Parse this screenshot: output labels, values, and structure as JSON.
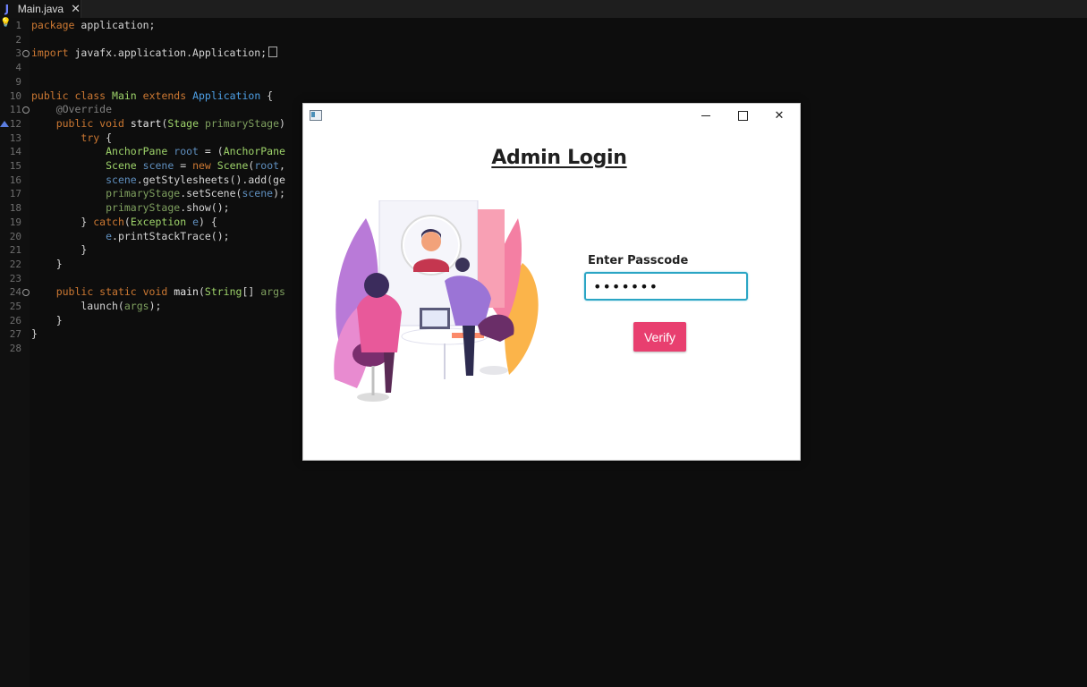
{
  "tab": {
    "icon": "J",
    "label": "Main.java",
    "close": "✕"
  },
  "code": [
    {
      "n": "1",
      "html": "<span class=\"kw\">package</span> application;"
    },
    {
      "n": "2",
      "html": ""
    },
    {
      "n": "3",
      "html": "<span class=\"kw\">import</span> javafx.application.Application;<span class=\"import-box\"></span>"
    },
    {
      "n": "4",
      "html": ""
    },
    {
      "n": "9",
      "html": ""
    },
    {
      "n": "10",
      "html": "<span class=\"kw\">public class</span> <span class=\"cls\">Main</span> <span class=\"kw\">extends</span> <span class=\"typ\">Application</span> {"
    },
    {
      "n": "11",
      "html": "    <span class=\"ann\">@Override</span>"
    },
    {
      "n": "12",
      "html": "    <span class=\"kw\">public void</span> <span class=\"fn\">start</span>(<span class=\"cls\">Stage</span> <span class=\"arg\">primaryStage</span>)"
    },
    {
      "n": "13",
      "html": "        <span class=\"kw\">try</span> {"
    },
    {
      "n": "14",
      "html": "            <span class=\"cls\">AnchorPane</span> <span class=\"var\">root</span> = (<span class=\"cls\">AnchorPane</span>"
    },
    {
      "n": "15",
      "html": "            <span class=\"cls\">Scene</span> <span class=\"var\">scene</span> = <span class=\"kw\">new</span> <span class=\"cls\">Scene</span>(<span class=\"var\">root</span>,"
    },
    {
      "n": "16",
      "html": "            <span class=\"var\">scene</span>.getStylesheets().add(ge"
    },
    {
      "n": "17",
      "html": "            <span class=\"arg\">primaryStage</span>.setScene(<span class=\"var\">scene</span>);"
    },
    {
      "n": "18",
      "html": "            <span class=\"arg\">primaryStage</span>.show();"
    },
    {
      "n": "19",
      "html": "        } <span class=\"kw\">catch</span>(<span class=\"cls\">Exception</span> <span class=\"var\">e</span>) {"
    },
    {
      "n": "20",
      "html": "            <span class=\"var\">e</span>.printStackTrace();"
    },
    {
      "n": "21",
      "html": "        }"
    },
    {
      "n": "22",
      "html": "    }"
    },
    {
      "n": "23",
      "html": ""
    },
    {
      "n": "24",
      "html": "    <span class=\"kw\">public static void</span> <span class=\"fn\">main</span>(<span class=\"cls\">String</span>[] <span class=\"arg\">args</span>"
    },
    {
      "n": "25",
      "html": "        launch(<span class=\"arg\">args</span>);"
    },
    {
      "n": "26",
      "html": "    }"
    },
    {
      "n": "27",
      "html": "}"
    },
    {
      "n": "28",
      "html": ""
    }
  ],
  "dialog": {
    "title": "Admin Login",
    "passcode_label": "Enter Passcode",
    "passcode_value": "•••••••",
    "verify_label": "Verify",
    "controls": {
      "minimize": "—",
      "maximize": "☐",
      "close": "✕"
    }
  },
  "colors": {
    "editor_bg": "#0d0d0d",
    "keyword": "#cc7832",
    "class": "#9ed36a",
    "accent_button": "#e83f6f",
    "input_border": "#2aa5c4"
  }
}
